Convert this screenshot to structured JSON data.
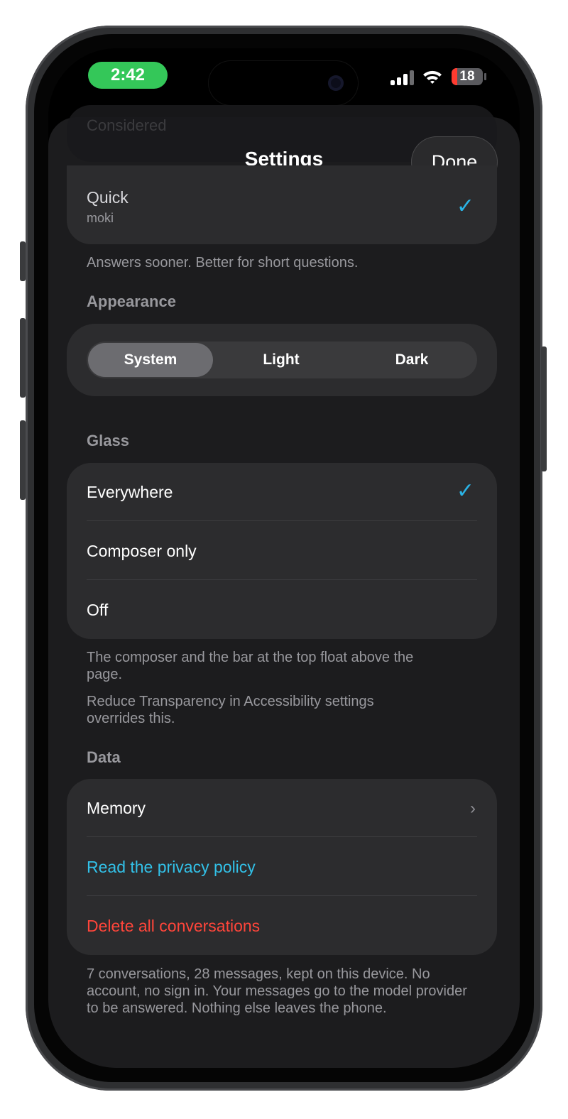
{
  "status_bar": {
    "time": "2:42",
    "battery": "18",
    "battery_level": 0.18
  },
  "header": {
    "title": "Settings",
    "done_label": "Done"
  },
  "model": {
    "ghost_item": "Considered",
    "selected_name": "Quick",
    "selected_sub": "moki",
    "footnote": "Answers sooner. Better for short questions."
  },
  "appearance": {
    "label": "Appearance",
    "options": [
      "System",
      "Light",
      "Dark"
    ],
    "selected": "System"
  },
  "glass": {
    "label": "Glass",
    "options": [
      "Everywhere",
      "Composer only",
      "Off"
    ],
    "selected": "Everywhere",
    "footnote1": "The composer and the bar at the top float above the page.",
    "footnote2": "Reduce Transparency in Accessibility settings overrides this."
  },
  "data_section": {
    "label": "Data",
    "memory": "Memory",
    "privacy": "Read the privacy policy",
    "delete": "Delete all conversations",
    "footnote": "7 conversations, 28 messages, kept on this device. No account, no sign in. Your messages go to the model provider to be answered. Nothing else leaves the phone."
  },
  "colors": {
    "accent": "#2ab3e6",
    "link": "#32c1e8",
    "destructive": "#ff453a",
    "time_pill": "#34c759"
  }
}
